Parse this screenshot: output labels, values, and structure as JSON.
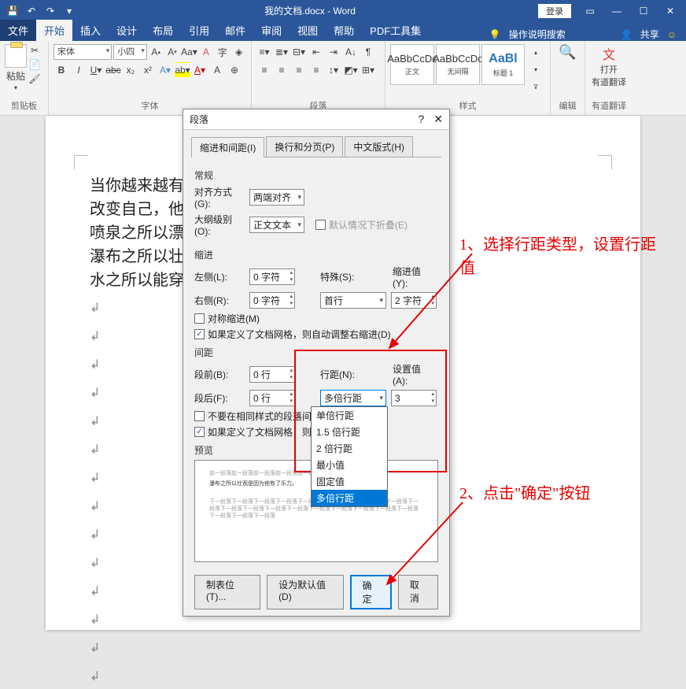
{
  "app_title": "我的文档.docx - Word",
  "login_label": "登录",
  "share_label": "共享",
  "search_hint": "操作说明搜索",
  "file_tab": "文件",
  "tabs": [
    "开始",
    "插入",
    "设计",
    "布局",
    "引用",
    "邮件",
    "审阅",
    "视图",
    "帮助",
    "PDF工具集"
  ],
  "ribbon": {
    "clipboard": {
      "paste": "粘贴",
      "label": "剪贴板"
    },
    "font": {
      "name": "宋体",
      "size": "小四",
      "label": "字体"
    },
    "paragraph": {
      "label": "段落"
    },
    "styles": {
      "label": "样式",
      "items": [
        {
          "prev": "AaBbCcDc",
          "name": "正文"
        },
        {
          "prev": "AaBbCcDc",
          "name": "无间隔"
        },
        {
          "prev": "AaBl",
          "name": "标题 1"
        }
      ]
    },
    "edit": "编辑",
    "translate": {
      "open": "打开",
      "name": "有道翻译",
      "label": "有道翻译"
    }
  },
  "body_lines": [
    "当你越来越有",
    "改变自己，他",
    "喷泉之所以漂",
    "瀑布之所以壮",
    "水之所以能穿"
  ],
  "dialog": {
    "title": "段落",
    "tabs": [
      "缩进和间距(I)",
      "换行和分页(P)",
      "中文版式(H)"
    ],
    "general": "常规",
    "align_label": "对齐方式(G):",
    "align_val": "两端对齐",
    "outline_label": "大纲级别(O):",
    "outline_val": "正文文本",
    "collapse_label": "默认情况下折叠(E)",
    "indent": "缩进",
    "left_label": "左侧(L):",
    "left_val": "0 字符",
    "right_label": "右侧(R):",
    "right_val": "0 字符",
    "special_label": "特殊(S):",
    "special_val": "首行",
    "indent_val_label": "缩进值(Y):",
    "indent_val": "2 字符",
    "mirror_label": "对称缩进(M)",
    "grid_indent_label": "如果定义了文档网格，则自动调整右缩进(D)",
    "spacing": "间距",
    "before_label": "段前(B):",
    "before_val": "0 行",
    "after_label": "段后(F):",
    "after_val": "0 行",
    "line_label": "行距(N):",
    "line_val": "多倍行距",
    "setval_label": "设置值(A):",
    "setval_val": "3",
    "nosame_label": "不要在相同样式的段落间增加",
    "grid_space_label": "如果定义了文档网格，则对齐",
    "preview": "预览",
    "dropdown_items": [
      "单倍行距",
      "1.5 倍行距",
      "2 倍行距",
      "最小值",
      "固定值",
      "多倍行距"
    ],
    "tabstops": "制表位(T)...",
    "setdefault": "设为默认值(D)",
    "ok": "确定",
    "cancel": "取消"
  },
  "annotations": {
    "a1": "1、选择行距类型，设置行距值",
    "a2": "2、点击\"确定\"按钮"
  }
}
